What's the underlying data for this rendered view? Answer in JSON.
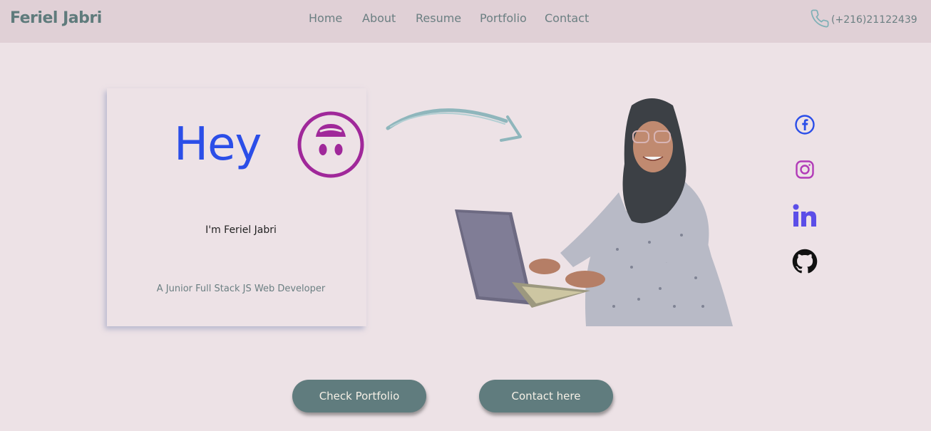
{
  "header": {
    "brand": "Feriel Jabri",
    "nav": [
      "Home",
      "About",
      "Resume",
      "Portfolio",
      "Contact"
    ],
    "phone": "(+216)21122439",
    "phone_icon": "phone-icon"
  },
  "hero": {
    "greeting": "Hey",
    "emoji_icon": "upside-down-face-icon",
    "arrow_icon": "curved-arrow-icon",
    "intro": "I'm Feriel Jabri",
    "subtitle": "A Junior Full Stack JS Web Developer",
    "photo": "portrait-with-laptop"
  },
  "social": [
    {
      "name": "facebook-icon",
      "color": "#2b4ee8"
    },
    {
      "name": "instagram-icon",
      "color": "#b23bb8"
    },
    {
      "name": "linkedin-icon",
      "color": "#5b4ee8"
    },
    {
      "name": "github-icon",
      "color": "#111111"
    }
  ],
  "actions": {
    "portfolio_label": "Check Portfolio",
    "contact_label": "Contact here"
  },
  "colors": {
    "background": "#ede2e6",
    "header": "#e0d0d6",
    "accent": "#2b4ee8",
    "button": "#607c7e"
  }
}
